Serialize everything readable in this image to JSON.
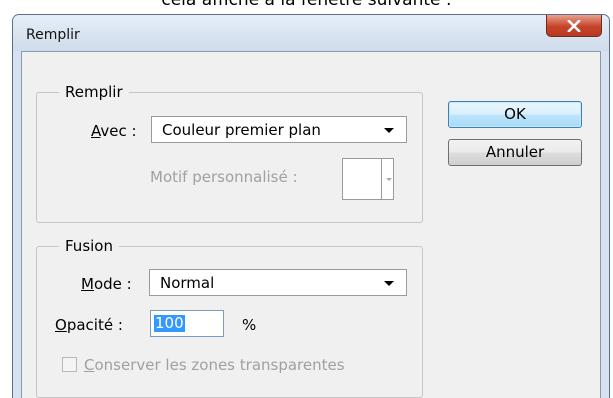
{
  "caption": "cela affiche à la fenêtre suivante :",
  "window": {
    "title": "Remplir",
    "close_glyph": "x"
  },
  "fill_group": {
    "legend": "Remplir",
    "avec_label_prefix": "A",
    "avec_label_rest": "vec :",
    "avec_value": "Couleur premier plan",
    "pattern_label": "Motif personnalisé :"
  },
  "blend_group": {
    "legend": "Fusion",
    "mode_label_prefix": "M",
    "mode_label_rest": "ode :",
    "mode_value": "Normal",
    "opacity_label_prefix": "O",
    "opacity_label_rest": "pacité :",
    "opacity_value": "100",
    "opacity_unit": "%",
    "preserve_prefix": "C",
    "preserve_rest": "onserver les zones transparentes",
    "preserve_checked": false
  },
  "buttons": {
    "ok": "OK",
    "cancel": "Annuler"
  }
}
